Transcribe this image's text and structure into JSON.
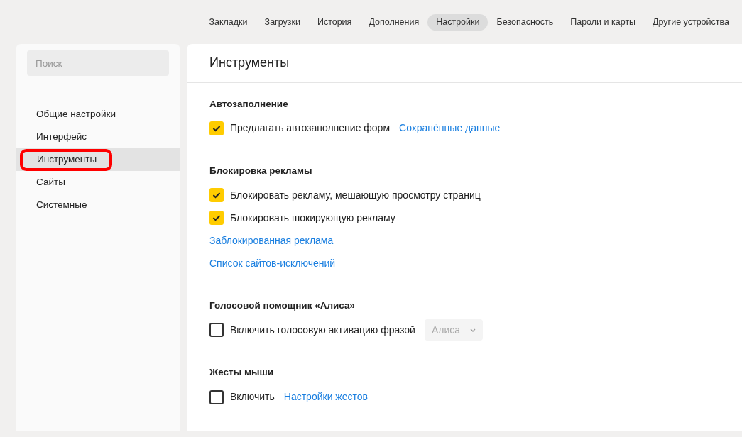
{
  "top_nav": [
    {
      "label": "Закладки",
      "selected": false
    },
    {
      "label": "Загрузки",
      "selected": false
    },
    {
      "label": "История",
      "selected": false
    },
    {
      "label": "Дополнения",
      "selected": false
    },
    {
      "label": "Настройки",
      "selected": true
    },
    {
      "label": "Безопасность",
      "selected": false
    },
    {
      "label": "Пароли и карты",
      "selected": false
    },
    {
      "label": "Другие устройства",
      "selected": false
    }
  ],
  "sidebar": {
    "search": {
      "placeholder": "Поиск"
    },
    "items": [
      {
        "label": "Общие настройки",
        "selected": false,
        "circled": false
      },
      {
        "label": "Интерфейс",
        "selected": false,
        "circled": false
      },
      {
        "label": "Инструменты",
        "selected": true,
        "circled": true
      },
      {
        "label": "Сайты",
        "selected": false,
        "circled": false
      },
      {
        "label": "Системные",
        "selected": false,
        "circled": false
      }
    ]
  },
  "page_title": "Инструменты",
  "sections": [
    {
      "title": "Автозаполнение",
      "rows": [
        {
          "kind": "checkbox",
          "label": "Предлагать автозаполнение форм",
          "checked": true,
          "link": "Сохранённые данные"
        }
      ]
    },
    {
      "title": "Блокировка рекламы",
      "rows": [
        {
          "kind": "checkbox",
          "label": "Блокировать рекламу, мешающую просмотру страниц",
          "checked": true
        },
        {
          "kind": "checkbox",
          "label": "Блокировать шокирующую рекламу",
          "checked": true
        },
        {
          "kind": "link",
          "label": "Заблокированная реклама"
        },
        {
          "kind": "link",
          "label": "Список сайтов-исключений"
        }
      ]
    },
    {
      "title": "Голосовой помощник «Алиса»",
      "rows": [
        {
          "kind": "checkbox",
          "label": "Включить голосовую активацию фразой",
          "checked": false,
          "select": "Алиса"
        }
      ]
    },
    {
      "title": "Жесты мыши",
      "rows": [
        {
          "kind": "checkbox",
          "label": "Включить",
          "checked": false,
          "link": "Настройки жестов"
        }
      ]
    }
  ]
}
